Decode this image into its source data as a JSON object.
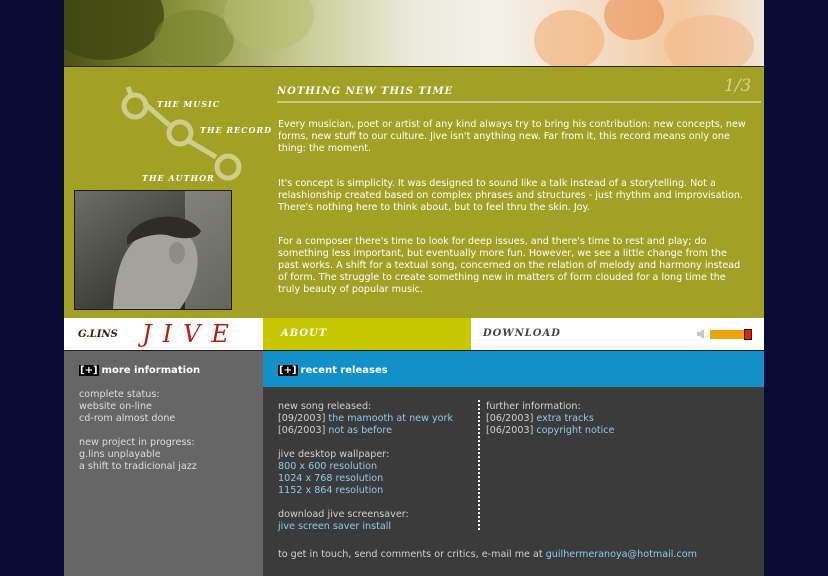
{
  "nav": {
    "music": "THE MUSIC",
    "record": "THE RECORD",
    "author": "THE AUTHOR"
  },
  "article": {
    "title": "NOTHING NEW THIS TIME",
    "page_counter": "1/3",
    "paragraphs": [
      "Every musician, poet or artist of any kind always try to bring his contribution: new concepts, new forms,  new stuff to our culture. Jive isn't anything new. Far from it, this record means only one thing: the moment.",
      "It's concept is simplicity. It was designed to sound like a talk instead of a storytelling. Not a relashionship created based on complex phrases and structures - just rhythm and improvisation. There's nothing here to think about, but to feel thru the skin. Joy.",
      "For a composer there's time to look for deep issues, and there's time to rest and play; do something less important, but eventually more fun. However, we see a little change from the past works. A shift for a textual song, concerned on the relation of melody and harmony instead of form. The struggle to create something new in matters of form clouded for a long time the truly beauty of popular music."
    ]
  },
  "logo": {
    "glins": "G.LINS",
    "jive": "JIVE"
  },
  "tabs": {
    "about": "ABOUT",
    "download": "DOWNLOAD"
  },
  "more_info": {
    "toggle": "[+]",
    "title": "more information",
    "lines": [
      "complete status:",
      "website on-line",
      "cd-rom almost done",
      "",
      "new project in progress:",
      "g.lins unplayable",
      "a shift to tradicional jazz"
    ]
  },
  "recent": {
    "toggle": "[+]",
    "title": "recent releases",
    "song_heading": "new song released:",
    "songs": [
      {
        "date": "[09/2003]",
        "title": "the mamooth at new york"
      },
      {
        "date": "[06/2003]",
        "title": "not as before"
      }
    ],
    "wallpaper_heading": "jive desktop wallpaper:",
    "wallpapers": [
      "800 x 600 resolution",
      "1024 x 768 resolution",
      "1152 x 864 resolution"
    ],
    "saver_heading": "download jive screensaver:",
    "saver_link": "jive screen saver install",
    "further_heading": "further information:",
    "further": [
      {
        "date": "[06/2003]",
        "title": "extra tracks"
      },
      {
        "date": "[06/2003]",
        "title": "copyright notice"
      }
    ],
    "contact_text": "to get in touch, send comments or critics, e-mail me at",
    "email": "guilhermeranoya@hotmail.com"
  },
  "colors": {
    "olive": "#a2a125",
    "tab_active": "#c8c600",
    "blue_band": "#1390c7",
    "link": "#8ec9ee",
    "logo_red": "#b02312"
  },
  "icons": [
    "speaker-icon",
    "volume-slider"
  ]
}
